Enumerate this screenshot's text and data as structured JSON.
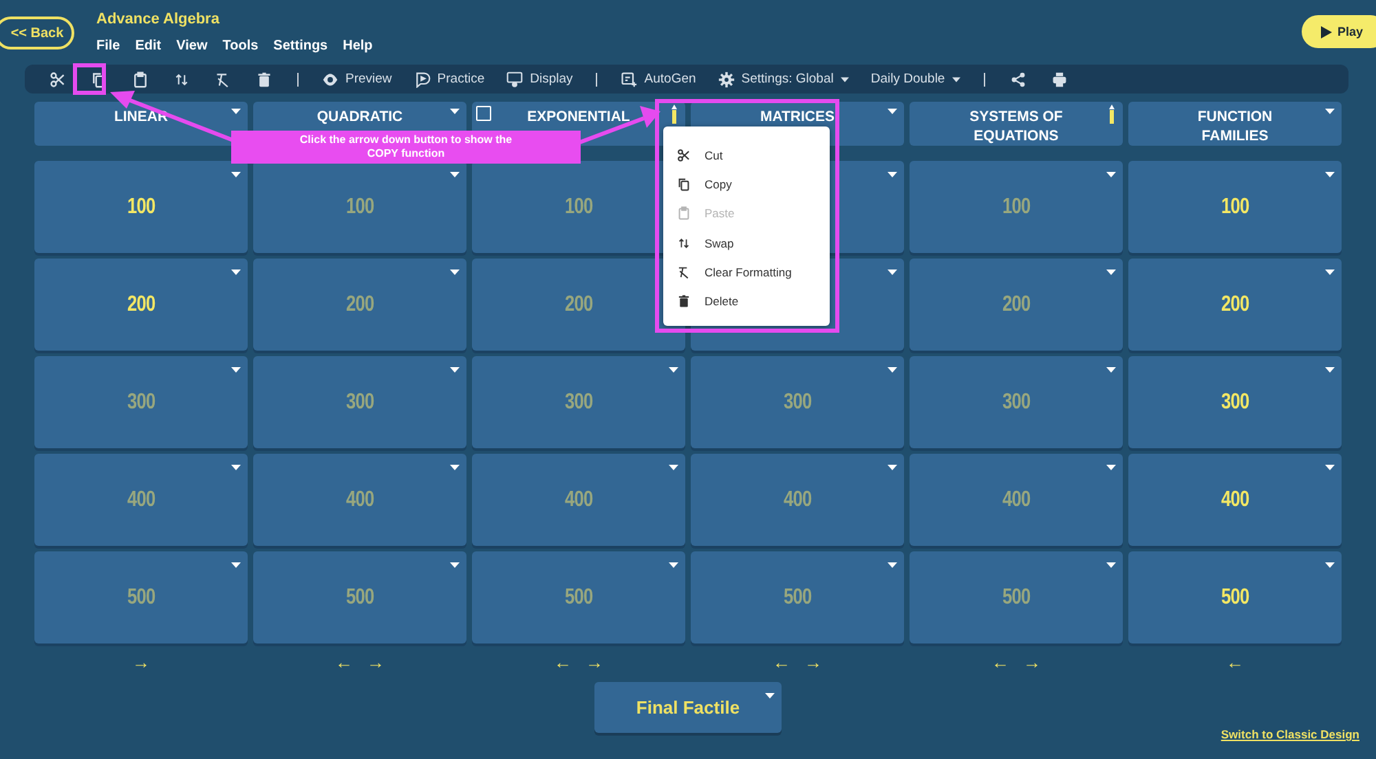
{
  "app": {
    "back_button": "<< Back",
    "title": "Advance Algebra",
    "menu": [
      "File",
      "Edit",
      "View",
      "Tools",
      "Settings",
      "Help"
    ],
    "play_button": "Play"
  },
  "toolbar": [
    {
      "kind": "cut"
    },
    {
      "kind": "copy"
    },
    {
      "kind": "paste"
    },
    {
      "kind": "swap"
    },
    {
      "kind": "clear"
    },
    {
      "kind": "delete"
    },
    {
      "kind": "divider"
    },
    {
      "kind": "preview",
      "label": "Preview"
    },
    {
      "kind": "practice",
      "label": "Practice"
    },
    {
      "kind": "display",
      "label": "Display"
    },
    {
      "kind": "divider"
    },
    {
      "kind": "autogen",
      "label": "AutoGen"
    },
    {
      "kind": "settings",
      "label": "Settings: Global",
      "dropdown": true
    },
    {
      "kind": "plain",
      "label": "Daily Double",
      "dropdown": true
    },
    {
      "kind": "divider"
    },
    {
      "kind": "share"
    },
    {
      "kind": "print"
    }
  ],
  "categories": [
    {
      "title": "LINEAR",
      "kind": "caret",
      "cells": [
        {
          "value": "100",
          "filled": true
        },
        {
          "value": "200",
          "filled": true
        },
        {
          "value": "300",
          "filled": false
        },
        {
          "value": "400",
          "filled": false
        },
        {
          "value": "500",
          "filled": false
        }
      ],
      "arrows": [
        "→"
      ]
    },
    {
      "title": "QUADRATIC",
      "kind": "caret",
      "cells": [
        {
          "value": "100",
          "filled": false
        },
        {
          "value": "200",
          "filled": false
        },
        {
          "value": "300",
          "filled": false
        },
        {
          "value": "400",
          "filled": false
        },
        {
          "value": "500",
          "filled": false
        }
      ],
      "arrows": [
        "←",
        "→"
      ]
    },
    {
      "title": "EXPONENTIAL",
      "kind": "bar",
      "checkbox": {
        "checked": false
      },
      "cells": [
        {
          "value": "100",
          "filled": false
        },
        {
          "value": "200",
          "filled": false
        },
        {
          "value": "300",
          "filled": false
        },
        {
          "value": "400",
          "filled": false
        },
        {
          "value": "500",
          "filled": false
        }
      ],
      "arrows": [
        "←",
        "→"
      ]
    },
    {
      "title": "MATRICES",
      "kind": "caret",
      "cells": [
        {},
        {},
        {
          "value": "300",
          "filled": false
        },
        {
          "value": "400",
          "filled": false
        },
        {
          "value": "500",
          "filled": false
        }
      ],
      "arrows": [
        "←",
        "→"
      ]
    },
    {
      "title": "SYSTEMS OF EQUATIONS",
      "kind": "bar",
      "cells": [
        {
          "value": "100",
          "filled": false
        },
        {
          "value": "200",
          "filled": false
        },
        {
          "value": "300",
          "filled": false
        },
        {
          "value": "400",
          "filled": false
        },
        {
          "value": "500",
          "filled": false
        }
      ],
      "arrows": [
        "←",
        "→"
      ]
    },
    {
      "title": "FUNCTION FAMILIES",
      "kind": "caret",
      "cells": [
        {
          "value": "100",
          "filled": true
        },
        {
          "value": "200",
          "filled": true
        },
        {
          "value": "300",
          "filled": true
        },
        {
          "value": "400",
          "filled": true
        },
        {
          "value": "500",
          "filled": true
        }
      ],
      "arrows": [
        "←"
      ]
    }
  ],
  "context_menu": [
    {
      "kind": "cut",
      "label": "Cut",
      "disabled": false
    },
    {
      "kind": "copy",
      "label": "Copy",
      "disabled": false
    },
    {
      "kind": "paste",
      "label": "Paste",
      "disabled": true
    },
    {
      "kind": "swap",
      "label": "Swap",
      "disabled": false
    },
    {
      "kind": "clear",
      "label": "Clear Formatting",
      "disabled": false
    },
    {
      "kind": "delete",
      "label": "Delete",
      "disabled": false
    }
  ],
  "final_button": "Final Factile",
  "classic_link": "Switch to Classic Design",
  "annotation": {
    "text": "Click the arrow down button to show the COPY function"
  }
}
